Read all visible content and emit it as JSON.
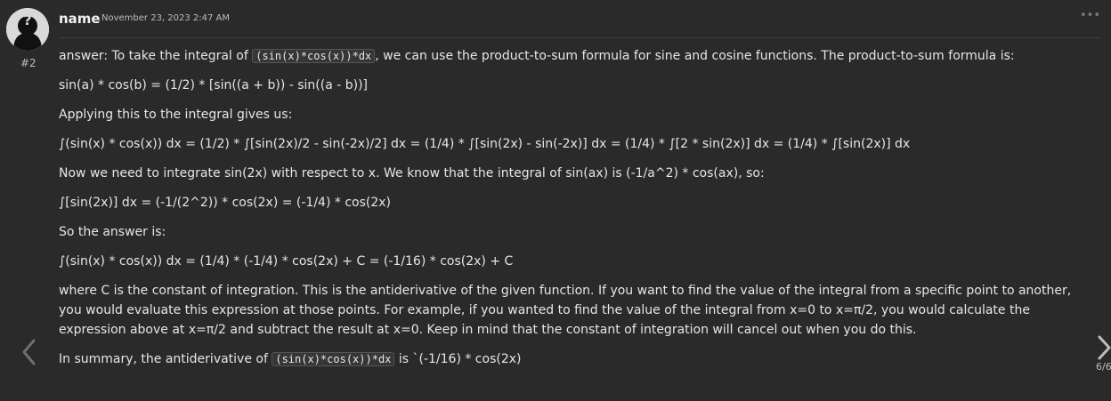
{
  "post": {
    "username": "name",
    "timestamp": "November 23, 2023 2:47 AM",
    "number": "#2",
    "more_menu": "•••"
  },
  "body": {
    "p1_prefix": "answer: To take the integral of ",
    "p1_code": "(sin(x)*cos(x))*dx",
    "p1_suffix": ", we can use the product-to-sum formula for sine and cosine functions. The product-to-sum formula is:",
    "p2": "sin(a) * cos(b) = (1/2) * [sin((a + b)) - sin((a - b))]",
    "p3": "Applying this to the integral gives us:",
    "p4": "∫(sin(x) * cos(x)) dx = (1/2) * ∫[sin(2x)/2 - sin(-2x)/2] dx = (1/4) * ∫[sin(2x) - sin(-2x)] dx = (1/4) * ∫[2 * sin(2x)] dx = (1/4) * ∫[sin(2x)] dx",
    "p5": "Now we need to integrate sin(2x) with respect to x. We know that the integral of sin(ax) is (-1/a^2) * cos(ax), so:",
    "p6": "∫[sin(2x)] dx = (-1/(2^2)) * cos(2x) = (-1/4) * cos(2x)",
    "p7": "So the answer is:",
    "p8": "∫(sin(x) * cos(x)) dx = (1/4) * (-1/4) * cos(2x) + C = (-1/16) * cos(2x) + C",
    "p9": "where C is the constant of integration. This is the antiderivative of the given function. If you want to find the value of the integral from a specific point to another, you would evaluate this expression at those points. For example, if you wanted to find the value of the integral from x=0 to x=π/2, you would calculate the expression above at x=π/2 and subtract the result at x=0. Keep in mind that the constant of integration will cancel out when you do this.",
    "p10_prefix": "In summary, the antiderivative of ",
    "p10_code": "(sin(x)*cos(x))*dx",
    "p10_suffix": " is `(-1/16) * cos(2x)"
  },
  "navigation": {
    "page_counter": "6/6"
  },
  "icons": {
    "avatar": "question-mark-avatar-icon",
    "more": "more-horizontal-icon",
    "prev": "chevron-left-icon",
    "next": "chevron-right-icon"
  }
}
